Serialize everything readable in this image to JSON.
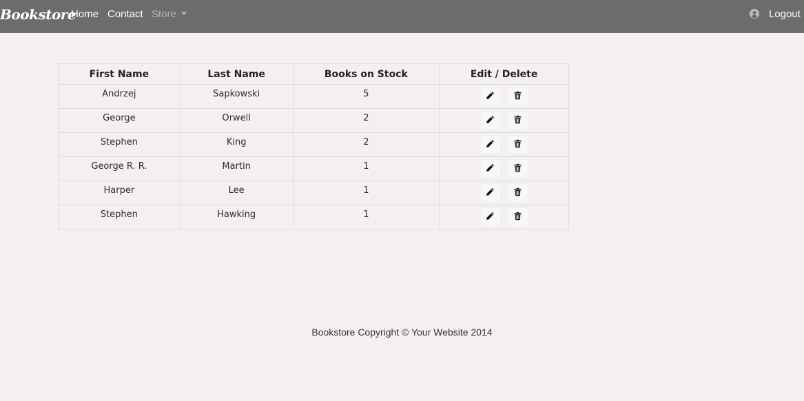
{
  "navbar": {
    "brand": "Bookstore",
    "links": {
      "home": "Home",
      "contact": "Contact",
      "store": "Store"
    },
    "logout": "Logout",
    "background": "#6e6c6a"
  },
  "table": {
    "headers": [
      "First Name",
      "Last Name",
      "Books on Stock",
      "Edit / Delete"
    ],
    "rows": [
      {
        "first": "Andrzej",
        "last": "Sapkowski",
        "stock": "5"
      },
      {
        "first": "George",
        "last": "Orwell",
        "stock": "2"
      },
      {
        "first": "Stephen",
        "last": "King",
        "stock": "2"
      },
      {
        "first": "George R. R.",
        "last": "Martin",
        "stock": "1"
      },
      {
        "first": "Harper",
        "last": "Lee",
        "stock": "1"
      },
      {
        "first": "Stephen",
        "last": "Hawking",
        "stock": "1"
      }
    ],
    "icons": {
      "edit": "pencil-icon",
      "delete": "trash-icon"
    }
  },
  "footer": {
    "text": "Bookstore Copyright © Your Website 2014"
  }
}
